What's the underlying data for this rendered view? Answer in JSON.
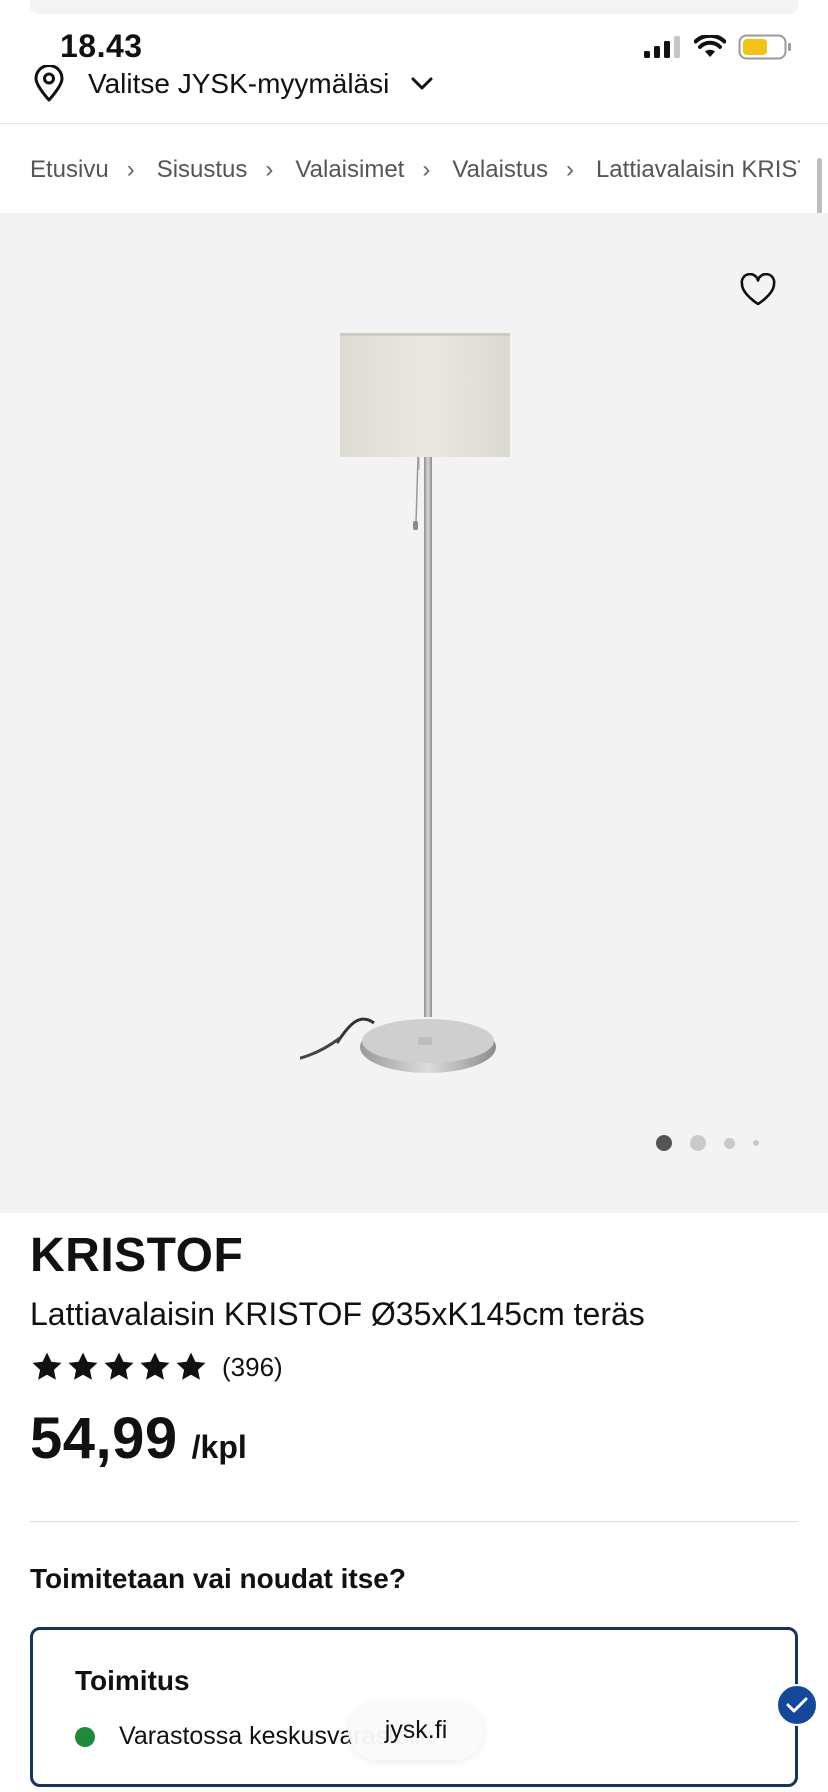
{
  "status_bar": {
    "time": "18.43",
    "battery_color": "#f2c21b"
  },
  "header": {
    "store_selector_label": "Valitse JYSK-myymäläsi",
    "icons": [
      "location-pin-icon",
      "chevron-down-icon"
    ]
  },
  "breadcrumb": [
    {
      "label": "Etusivu"
    },
    {
      "label": "Sisustus"
    },
    {
      "label": "Valaisimet"
    },
    {
      "label": "Valaistus"
    },
    {
      "label": "Lattiavalaisin KRISTOF"
    }
  ],
  "gallery": {
    "image_count": 4,
    "active_index": 0
  },
  "product": {
    "brand": "KRISTOF",
    "name": "Lattiavalaisin KRISTOF Ø35xK145cm teräs",
    "rating": 5,
    "review_count": "(396)",
    "price": "54,99",
    "unit": "/kpl"
  },
  "delivery": {
    "section_title": "Toimitetaan vai noudat itse?",
    "option_title": "Toimitus",
    "stock_text": "Varastossa keskusvarastolla",
    "stock_color": "#1f8a3a",
    "accent_color": "#15355f"
  },
  "browser": {
    "url": "jysk.fi"
  }
}
